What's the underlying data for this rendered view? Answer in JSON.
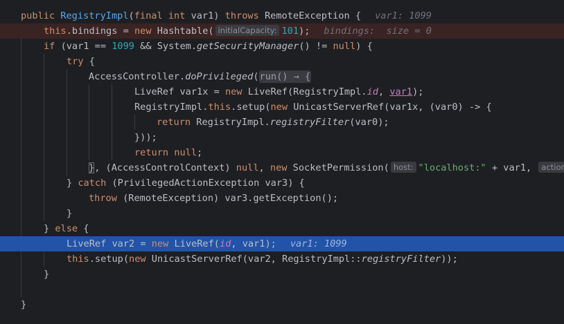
{
  "editor": {
    "lines": [
      {
        "indent": 1,
        "tokens": []
      },
      {
        "id": "l1"
      },
      {
        "id": "l2"
      }
    ]
  },
  "code": {
    "l1_kw_public": "public ",
    "l1_name": "RegistryImpl",
    "l1_open": "(",
    "l1_kw_final": "final ",
    "l1_kw_int": "int ",
    "l1_var": "var1) ",
    "l1_kw_throws": "throws ",
    "l1_exc": "RemoteException {",
    "l1_inline": "var1: 1099",
    "l2_kw_this": "this",
    "l2_field": ".bindings = ",
    "l2_kw_new": "new ",
    "l2_cls": "Hashtable(",
    "l2_hint": "initialCapacity:",
    "l2_num": "101",
    "l2_end": ");",
    "l2_inline_name": "bindings:",
    "l2_inline_val": "size = 0",
    "l3_kw_if": "if ",
    "l3_a": "(var1 == ",
    "l3_num": "1099",
    "l3_b": " && System.",
    "l3_fn": "getSecurityManager",
    "l3_c": "() != ",
    "l3_kw_null": "null",
    "l3_d": ") {",
    "l4_kw_try": "try ",
    "l4_b": "{",
    "l5_a": "AccessController.",
    "l5_fn": "doPrivileged",
    "l5_b": "(",
    "l5_lambda": "run() → {",
    "l6_a": "LiveRef var1x = ",
    "l6_kw_new": "new ",
    "l6_b": "LiveRef(RegistryImpl.",
    "l6_fld": "id",
    "l6_c": ", ",
    "l6_param": "var1",
    "l6_d": ");",
    "l7_a": "RegistryImpl.",
    "l7_kw_this": "this",
    "l7_b": ".setup(",
    "l7_kw_new": "new ",
    "l7_c": "UnicastServerRef(var1x, (var0) -> {",
    "l8_kw_return": "return ",
    "l8_a": "RegistryImpl.",
    "l8_fn": "registryFilter",
    "l8_b": "(var0);",
    "l9_a": "}));",
    "l10_kw_return": "return ",
    "l10_kw_null": "null",
    "l10_b": ";",
    "l11_brace": "}",
    "l11_a": ", (AccessControlContext) ",
    "l11_kw_null": "null",
    "l11_b": ", ",
    "l11_kw_new": "new ",
    "l11_c": "SocketPermission(",
    "l11_hint_host": "host:",
    "l11_str": "\"localhost:\"",
    "l11_d": " + var1, ",
    "l11_hint_action": "action:",
    "l11_e": "\"",
    "l12_a": "} ",
    "l12_kw_catch": "catch ",
    "l12_b": "(PrivilegedActionException var3) {",
    "l13_kw_throw": "throw ",
    "l13_a": "(RemoteException) var3.getException();",
    "l14_a": "}",
    "l15_a": "} ",
    "l15_kw_else": "else ",
    "l15_b": "{",
    "l16_a": "LiveRef var2 = ",
    "l16_kw_new": "new ",
    "l16_b": "LiveRef(",
    "l16_fld": "id",
    "l16_c": ", var1);",
    "l16_inline": "var1: 1099",
    "l17_kw_this": "this",
    "l17_a": ".setup(",
    "l17_kw_new": "new ",
    "l17_b": "UnicastServerRef(var2, RegistryImpl::",
    "l17_fn": "registryFilter",
    "l17_c": "));",
    "l18_a": "}",
    "l20_a": "}"
  },
  "colors": {
    "background": "#1e1f22",
    "keyword": "#cf8e6d",
    "method": "#56a8f5",
    "number": "#2aacb8",
    "string": "#6aab73",
    "field": "#c77dbb",
    "breakpoint_line": "#3a2323",
    "execution_line": "#2154a8"
  }
}
